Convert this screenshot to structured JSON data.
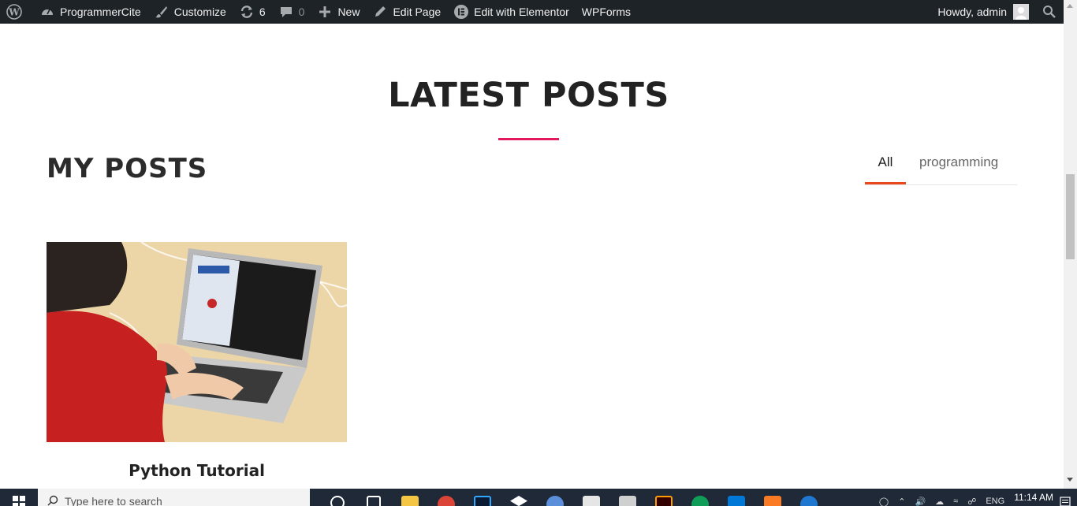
{
  "adminbar": {
    "site_name": "ProgrammerCite",
    "customize": "Customize",
    "updates_count": "6",
    "comments_count": "0",
    "new": "New",
    "edit_page": "Edit Page",
    "edit_elementor": "Edit with Elementor",
    "wpforms": "WPForms",
    "howdy": "Howdy, admin"
  },
  "section": {
    "heading": "LATEST POSTS",
    "subheading": "MY POSTS",
    "filters": [
      {
        "label": "All",
        "active": true
      },
      {
        "label": "programming",
        "active": false
      }
    ]
  },
  "posts": [
    {
      "title": "Python Tutorial",
      "image": "person-typing-on-laptop-photo"
    }
  ],
  "taskbar": {
    "search_placeholder": "Type here to search",
    "language": "ENG",
    "time": "11:14 AM"
  },
  "colors": {
    "accent_underline": "#e2195a",
    "filter_active": "#e8481a",
    "adminbar_bg": "#1d2327",
    "taskbar_bg": "#1f2937"
  }
}
